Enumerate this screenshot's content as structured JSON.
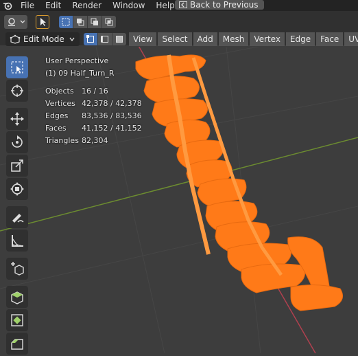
{
  "topbar": {
    "menus": [
      "File",
      "Edit",
      "Render",
      "Window",
      "Help"
    ],
    "back_label": "Back to Previous"
  },
  "header": {
    "mode": "Edit Mode",
    "menus": [
      "View",
      "Select",
      "Add",
      "Mesh",
      "Vertex",
      "Edge",
      "Face",
      "UV"
    ]
  },
  "viewport": {
    "perspective": "User Perspective",
    "object_name": "(1) 09 Half_Turn_R",
    "stats": [
      {
        "key": "Objects",
        "value": "16 / 16"
      },
      {
        "key": "Vertices",
        "value": "42,378 / 42,378"
      },
      {
        "key": "Edges",
        "value": "83,536 / 83,536"
      },
      {
        "key": "Faces",
        "value": "41,152 / 41,152"
      },
      {
        "key": "Triangles",
        "value": "82,304"
      }
    ]
  },
  "toolbar": {
    "tools": [
      "select-box-icon",
      "cursor-icon",
      "move-icon",
      "rotate-icon",
      "scale-icon",
      "transform-icon",
      "annotate-icon",
      "measure-icon",
      "add-cube-icon",
      "extrude-icon",
      "inset-icon",
      "bevel-icon"
    ]
  },
  "colors": {
    "mesh_orange": "#ff7a18",
    "active_blue": "#4772b3",
    "x_axis": "#b0404f",
    "y_axis": "#6c8c30"
  }
}
